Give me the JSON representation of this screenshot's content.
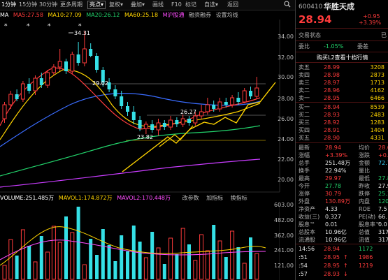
{
  "toolbar": {
    "items": [
      "1分钟",
      "15分钟",
      "30分钟",
      "更多周期",
      "亮点",
      "复权",
      "叠加",
      "画线",
      "F10",
      "标记",
      "自选",
      "返回"
    ],
    "active_index": 0,
    "selected_index": 4,
    "search_icon": "search-icon"
  },
  "ma_bar": {
    "ma": "MA",
    "ma5": "MA5:27.58",
    "ma10": "MA10:27.09",
    "ma20": "MA20:26.12",
    "ma60": "MA60:25.18",
    "extra1": "M沪股通",
    "extra2": "融资融券",
    "extra3": "设置均线",
    "colors": {
      "ma5": "#ff3b3b",
      "ma10": "#ffd400",
      "ma20": "#22d36b",
      "ma60": "#c93cff",
      "white": "#ffffff"
    }
  },
  "price_axis": [
    "34.00",
    "32.00",
    "30.00",
    "28.00",
    "26.00",
    "24.00",
    "22.00",
    "20.00"
  ],
  "annotations": {
    "high": "34.31",
    "a": "29.02",
    "b": "26.27",
    "c": "23.82"
  },
  "volume": {
    "header": {
      "vol": "VOLUME:251.485万",
      "mavol1": "MAVOL1:174.872万",
      "mavol2": "MAVOL2:170.448万"
    },
    "links": [
      "改参数",
      "加指标",
      "换指标"
    ],
    "axis": [
      "603.00",
      "482.00",
      "362.00",
      "241.00",
      "121.00"
    ]
  },
  "quote": {
    "code": "600410",
    "name": "华胜天成",
    "price": "28.94",
    "change": "+0.95",
    "change_pct": "+3.39%",
    "trade_status_label": "交易状态",
    "trade_status_value": "已",
    "webi_label": "委比",
    "webi_value": "-1.05%",
    "weicha_label": "委差",
    "l2_link": "购买L2查看十档行情",
    "asks": [
      {
        "label": "卖五",
        "price": "28.99",
        "vol": "3208"
      },
      {
        "label": "卖四",
        "price": "28.98",
        "vol": "2873"
      },
      {
        "label": "卖三",
        "price": "28.97",
        "vol": "1713"
      },
      {
        "label": "卖二",
        "price": "28.96",
        "vol": "4162"
      },
      {
        "label": "卖一",
        "price": "28.95",
        "vol": "6466"
      }
    ],
    "bids": [
      {
        "label": "买一",
        "price": "28.94",
        "vol": "8539"
      },
      {
        "label": "买二",
        "price": "28.93",
        "vol": "2483"
      },
      {
        "label": "买三",
        "price": "28.92",
        "vol": "1283"
      },
      {
        "label": "买四",
        "price": "28.91",
        "vol": "1404"
      },
      {
        "label": "买五",
        "price": "28.90",
        "vol": "4331"
      }
    ],
    "stats": [
      {
        "l1": "最新",
        "v1": "28.94",
        "c1": "red",
        "l2": "均价",
        "v2": "28.6",
        "c2": "red"
      },
      {
        "l1": "涨幅",
        "v1": "+3.39%",
        "c1": "red",
        "l2": "涨跌",
        "v2": "+0.9",
        "c2": "red"
      },
      {
        "l1": "总手",
        "v1": "251.48万",
        "c1": "white",
        "l2": "金额",
        "v2": "72.7",
        "c2": "cyan"
      },
      {
        "l1": "换手",
        "v1": "22.94%",
        "c1": "white",
        "l2": "量比",
        "v2": "",
        "c2": "white"
      },
      {
        "l1": "最高",
        "v1": "29.97",
        "c1": "red",
        "l2": "最低",
        "v2": "27.8",
        "c2": "green"
      },
      {
        "l1": "今开",
        "v1": "27.78",
        "c1": "green",
        "l2": "昨收",
        "v2": "27.9",
        "c2": "white"
      },
      {
        "l1": "涨停",
        "v1": "30.79",
        "c1": "red",
        "l2": "跌停",
        "v2": "25.1",
        "c2": "green"
      },
      {
        "l1": "外盘",
        "v1": "130.89万",
        "c1": "red",
        "l2": "内盘",
        "v2": "120.6",
        "c2": "green"
      },
      {
        "l1": "净资产",
        "v1": "4.33",
        "c1": "white",
        "l2": "ROE",
        "v2": "7.5",
        "c2": "white"
      },
      {
        "l1": "收益(三)",
        "v1": "0.327",
        "c1": "white",
        "l2": "PE(动)",
        "v2": "66.",
        "c2": "white"
      },
      {
        "l1": "股息™",
        "v1": "0.01",
        "c1": "white",
        "l2": "股息率™",
        "v2": "0.0",
        "c2": "white"
      },
      {
        "l1": "总股本",
        "v1": "10.96亿",
        "c1": "white",
        "l2": "总值",
        "v2": "317",
        "c2": "white"
      },
      {
        "l1": "流通股",
        "v1": "10.96亿",
        "c1": "white",
        "l2": "流值",
        "v2": "317",
        "c2": "white"
      }
    ],
    "ticks": [
      {
        "time": "14:56",
        "price": "28.94",
        "pc": "red",
        "vol": "1172",
        "vc": "green"
      },
      {
        "time": ":51",
        "price": "28.95",
        "pc": "red",
        "arrow": "↑",
        "vol": "1986",
        "vc": "red"
      },
      {
        "time": ":54",
        "price": "28.95",
        "pc": "red",
        "arrow": "↑",
        "vol": "1219",
        "vc": "red"
      },
      {
        "time": ":57",
        "price": "28.93",
        "pc": "red",
        "arrow": "↓",
        "vol": "",
        "vc": "green"
      }
    ]
  }
}
